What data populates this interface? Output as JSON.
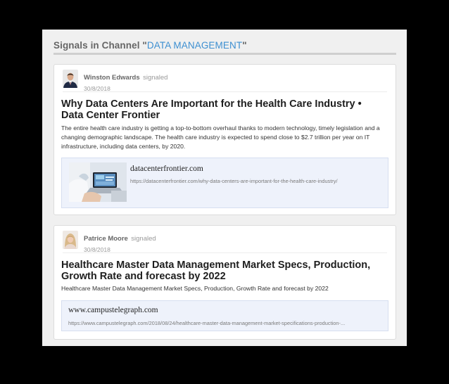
{
  "header": {
    "prefix": "Signals in Channel \"",
    "channel": "DATA MANAGEMENT",
    "suffix": "\""
  },
  "signals": [
    {
      "author": "Winston Edwards",
      "action": "signaled",
      "date": "30/8/2018",
      "title": "Why Data Centers Are Important for the Health Care Industry • Data Center Frontier",
      "description": "The entire health care industry is getting a top-to-bottom overhaul thanks to modern technology, timely legislation and a changing demographic landscape. The health care industry is expected to spend close to $2.7 trillion per year on IT infrastructure, including data centers, by 2020.",
      "link": {
        "domain": "datacenterfrontier.com",
        "url": "https://datacenterfrontier.com/why-data-centers-are-important-for-the-health-care-industry/"
      }
    },
    {
      "author": "Patrice Moore",
      "action": "signaled",
      "date": "30/8/2018",
      "title": "Healthcare Master Data Management Market Specs, Production, Growth Rate and forecast by 2022",
      "description": "Healthcare Master Data Management Market Specs, Production, Growth Rate and forecast by 2022",
      "link": {
        "domain": "www.campustelegraph.com",
        "url": "https://www.campustelegraph.com/2018/08/24/healthcare-master-data-management-market-specifications-production-..."
      }
    }
  ],
  "colors": {
    "channel_link": "#3d8fd1",
    "link_box_bg": "#eef2fb"
  }
}
